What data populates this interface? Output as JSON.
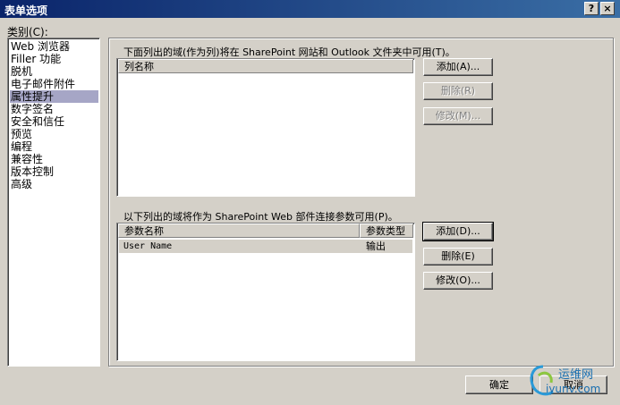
{
  "window": {
    "title": "表单选项",
    "help_button": "?",
    "close_button": "×"
  },
  "category": {
    "label": "类别(C):",
    "items": [
      {
        "label": "Web 浏览器"
      },
      {
        "label": "Filler 功能"
      },
      {
        "label": "脱机"
      },
      {
        "label": "电子邮件附件"
      },
      {
        "label": "属性提升",
        "selected": true
      },
      {
        "label": "数字签名"
      },
      {
        "label": "安全和信任"
      },
      {
        "label": "预览"
      },
      {
        "label": "编程"
      },
      {
        "label": "兼容性"
      },
      {
        "label": "版本控制"
      },
      {
        "label": "高级"
      }
    ]
  },
  "promotion": {
    "description": "下面列出的域(作为列)将在 SharePoint 网站和 Outlook 文件夹中可用(T)。",
    "column_header": "列名称",
    "add_button": "添加(A)...",
    "remove_button": "删除(R)",
    "modify_button": "修改(M)..."
  },
  "webpart": {
    "description": "以下列出的域将作为 SharePoint Web 部件连接参数可用(P)。",
    "columns": [
      "参数名称",
      "参数类型"
    ],
    "rows": [
      {
        "name": "User Name",
        "type": "输出"
      }
    ],
    "add_button": "添加(D)...",
    "remove_button": "删除(E)",
    "modify_button": "修改(O)..."
  },
  "footer": {
    "ok_button": "确定",
    "cancel_button": "取消"
  },
  "watermark": {
    "text": "运维网",
    "url": "iyunv.com"
  }
}
